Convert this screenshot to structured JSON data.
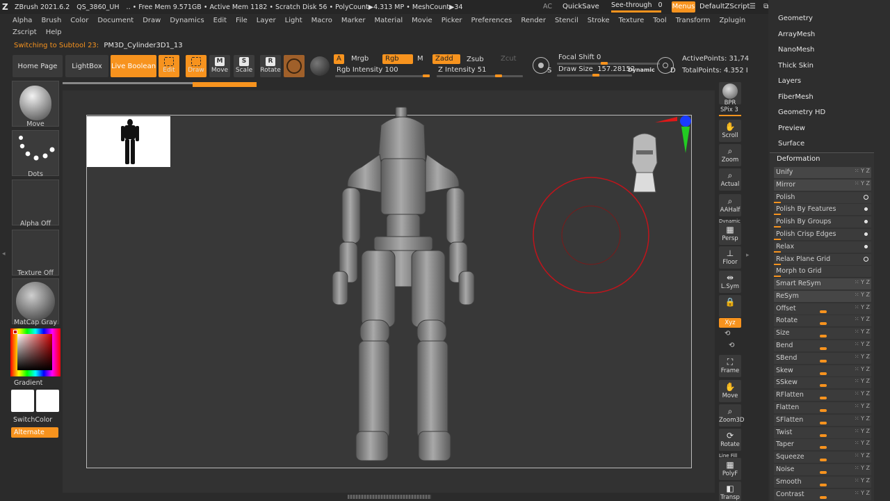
{
  "titlebar": {
    "app": "ZBrush 2021.6.2",
    "doc": "QS_3860_UH",
    "stats": ".. • Free Mem 9.571GB • Active Mem 1182 • Scratch Disk 56 • PolyCount▶4.313 MP • MeshCount▶34",
    "ac": "AC",
    "quicksave": "QuickSave",
    "seethrough": "See-through",
    "seethrough_val": "0",
    "menus": "Menus",
    "zscript": "DefaultZScript"
  },
  "menubar": {
    "row1": [
      "Alpha",
      "Brush",
      "Color",
      "Document",
      "Draw",
      "Dynamics",
      "Edit",
      "File",
      "Layer",
      "Light",
      "Macro",
      "Marker",
      "Material",
      "Movie",
      "Picker",
      "Preferences",
      "Render",
      "Stencil",
      "Stroke",
      "Texture",
      "Tool",
      "Transform",
      "Zplugin"
    ],
    "row2": [
      "Zscript",
      "Help"
    ]
  },
  "status": {
    "switching": "Switching to Subtool 23:",
    "subtool": "PM3D_Cylinder3D1_13"
  },
  "toolbar": {
    "home": "Home Page",
    "lightbox": "LightBox",
    "liveboolean": "Live Boolean",
    "edit": "Edit",
    "draw": "Draw",
    "move": "Move",
    "scale": "Scale",
    "rotate": "Rotate",
    "a": "A",
    "mrgb": "Mrgb",
    "rgb": "Rgb",
    "m": "M",
    "rgb_intensity": "Rgb Intensity 100",
    "zadd": "Zadd",
    "zsub": "Zsub",
    "zcut": "Zcut",
    "z_intensity": "Z Intensity 51",
    "focal_shift": "Focal Shift 0",
    "draw_size": "Draw Size",
    "draw_size_val": "157.28152",
    "dynamic": "Dynamic",
    "active_points": "ActivePoints: 31,74",
    "total_points": "TotalPoints: 4.352 I",
    "s_label": "S",
    "d_label": "D"
  },
  "leftpanel": {
    "move": "Move",
    "dots": "Dots",
    "alpha": "Alpha Off",
    "texture": "Texture Off",
    "material": "MatCap Gray",
    "gradient": "Gradient",
    "switchcolor": "SwitchColor",
    "alternate": "Alternate"
  },
  "rightdock": {
    "bpr": "BPR",
    "spix": "SPix 3",
    "scroll": "Scroll",
    "zoom": "Zoom",
    "actual": "Actual",
    "aahalf": "AAHalf",
    "dynamic": "Dynamic",
    "persp": "Persp",
    "floor": "Floor",
    "lsym": "L.Sym",
    "xyz": "Xyz",
    "frame": "Frame",
    "move": "Move",
    "zoom3d": "Zoom3D",
    "rotate": "Rotate",
    "linefill": "Line Fill",
    "polyf": "PolyF",
    "transp": "Transp"
  },
  "palette": {
    "headers": [
      "Geometry",
      "ArrayMesh",
      "NanoMesh",
      "Thick Skin",
      "Layers",
      "FiberMesh",
      "Geometry HD",
      "Preview",
      "Surface"
    ],
    "deformation": "Deformation",
    "items": [
      "Unify",
      "Mirror",
      "Polish",
      "Polish By Features",
      "Polish By Groups",
      "Polish Crisp Edges",
      "Relax",
      "Relax Plane Grid",
      "Morph to Grid",
      "Smart ReSym",
      "ReSym",
      "Offset",
      "Rotate",
      "Size",
      "Bend",
      "SBend",
      "Skew",
      "SSkew",
      "RFlatten",
      "Flatten",
      "SFlatten",
      "Twist",
      "Taper",
      "Squeeze",
      "Noise",
      "Smooth",
      "Contrast"
    ]
  },
  "colors": {
    "accent": "#f7931e",
    "bg": "#2b2b2b",
    "canvas": "#383838",
    "brush_ring": "#c0141b"
  }
}
